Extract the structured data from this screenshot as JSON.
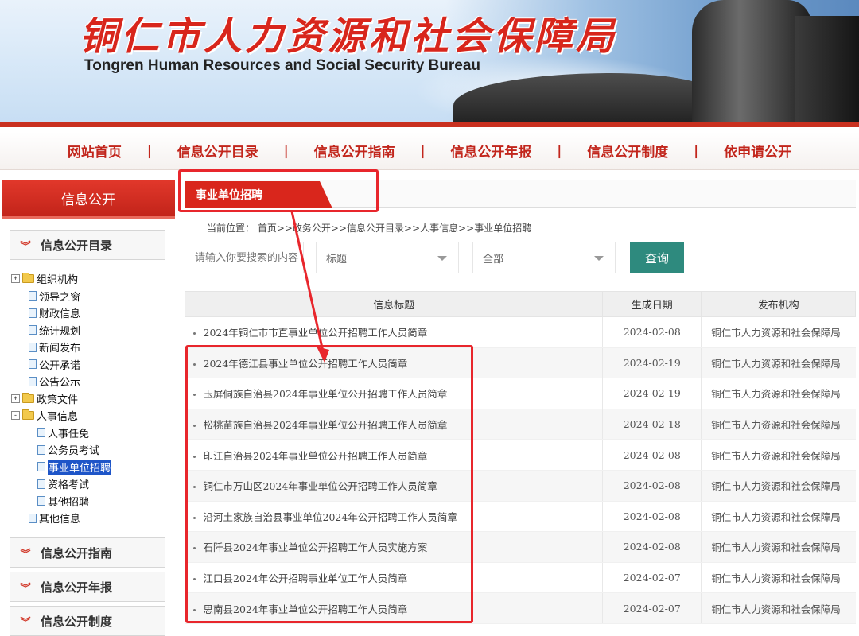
{
  "header": {
    "title_cn": "铜仁市人力资源和社会保障局",
    "title_en": "Tongren Human Resources and Social Security Bureau"
  },
  "nav": {
    "items": [
      "网站首页",
      "信息公开目录",
      "信息公开指南",
      "信息公开年报",
      "信息公开制度",
      "依申请公开"
    ],
    "separator": "|"
  },
  "sidebar": {
    "header": "信息公开",
    "sections": [
      "信息公开目录",
      "信息公开指南",
      "信息公开年报",
      "信息公开制度"
    ],
    "tree": [
      {
        "label": "组织机构",
        "type": "folder",
        "toggle": "+"
      },
      {
        "label": "领导之窗",
        "type": "doc"
      },
      {
        "label": "财政信息",
        "type": "doc"
      },
      {
        "label": "统计规划",
        "type": "doc"
      },
      {
        "label": "新闻发布",
        "type": "doc"
      },
      {
        "label": "公开承诺",
        "type": "doc"
      },
      {
        "label": "公告公示",
        "type": "doc"
      },
      {
        "label": "政策文件",
        "type": "folder",
        "toggle": "+"
      },
      {
        "label": "人事信息",
        "type": "folder",
        "toggle": "-"
      },
      {
        "label": "人事任免",
        "type": "doc"
      },
      {
        "label": "公务员考试",
        "type": "doc"
      },
      {
        "label": "事业单位招聘",
        "type": "doc"
      },
      {
        "label": "资格考试",
        "type": "doc"
      },
      {
        "label": "其他招聘",
        "type": "doc"
      },
      {
        "label": "其他信息",
        "type": "doc"
      }
    ]
  },
  "main": {
    "tab_label": "事业单位招聘",
    "breadcrumb": "当前位置：  首页>>政务公开>>信息公开目录>>人事信息>>事业单位招聘",
    "search": {
      "placeholder": "请输入你要搜索的内容"
    },
    "select_field": "标题",
    "select_scope": "全部",
    "query_button": "查询",
    "table": {
      "headers": [
        "信息标题",
        "生成日期",
        "发布机构"
      ],
      "rows": [
        {
          "title": "2024年铜仁市市直事业单位公开招聘工作人员简章",
          "date": "2024-02-08",
          "org": "铜仁市人力资源和社会保障局"
        },
        {
          "title": "2024年德江县事业单位公开招聘工作人员简章",
          "date": "2024-02-19",
          "org": "铜仁市人力资源和社会保障局"
        },
        {
          "title": "玉屏侗族自治县2024年事业单位公开招聘工作人员简章",
          "date": "2024-02-19",
          "org": "铜仁市人力资源和社会保障局"
        },
        {
          "title": "松桃苗族自治县2024年事业单位公开招聘工作人员简章",
          "date": "2024-02-18",
          "org": "铜仁市人力资源和社会保障局"
        },
        {
          "title": "印江自治县2024年事业单位公开招聘工作人员简章",
          "date": "2024-02-08",
          "org": "铜仁市人力资源和社会保障局"
        },
        {
          "title": "铜仁市万山区2024年事业单位公开招聘工作人员简章",
          "date": "2024-02-08",
          "org": "铜仁市人力资源和社会保障局"
        },
        {
          "title": "沿河土家族自治县事业单位2024年公开招聘工作人员简章",
          "date": "2024-02-08",
          "org": "铜仁市人力资源和社会保障局"
        },
        {
          "title": "石阡县2024年事业单位公开招聘工作人员实施方案",
          "date": "2024-02-08",
          "org": "铜仁市人力资源和社会保障局"
        },
        {
          "title": "江口县2024年公开招聘事业单位工作人员简章",
          "date": "2024-02-07",
          "org": "铜仁市人力资源和社会保障局"
        },
        {
          "title": "思南县2024年事业单位公开招聘工作人员简章",
          "date": "2024-02-07",
          "org": "铜仁市人力资源和社会保障局"
        }
      ]
    }
  },
  "colors": {
    "brand_red": "#d9261c",
    "accent_teal": "#2e8a7e",
    "highlight_red": "#e8262c"
  }
}
